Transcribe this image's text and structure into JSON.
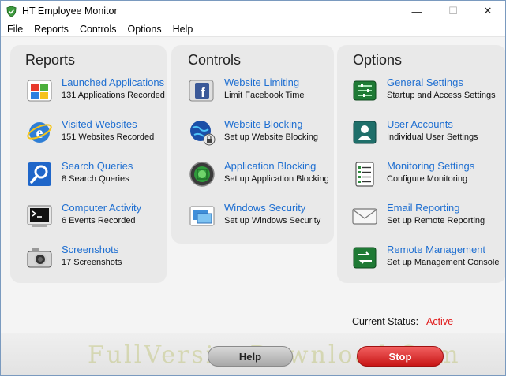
{
  "window": {
    "title": "HT Employee Monitor",
    "minimize_glyph": "—",
    "maximize_glyph": "☐",
    "close_glyph": "✕"
  },
  "menu": [
    "File",
    "Reports",
    "Controls",
    "Options",
    "Help"
  ],
  "reports": {
    "title": "Reports",
    "items": [
      {
        "label": "Launched Applications",
        "sub": "131 Applications Recorded",
        "icon": "applications-icon"
      },
      {
        "label": "Visited Websites",
        "sub": "151 Websites Recorded",
        "icon": "internet-explorer-icon"
      },
      {
        "label": "Search Queries",
        "sub": "8 Search Queries",
        "icon": "search-icon"
      },
      {
        "label": "Computer Activity",
        "sub": "6 Events Recorded",
        "icon": "terminal-icon"
      },
      {
        "label": "Screenshots",
        "sub": "17 Screenshots",
        "icon": "camera-icon"
      }
    ]
  },
  "controls": {
    "title": "Controls",
    "items": [
      {
        "label": "Website Limiting",
        "sub": "Limit Facebook Time",
        "icon": "facebook-icon"
      },
      {
        "label": "Website Blocking",
        "sub": "Set up Website Blocking",
        "icon": "globe-lock-icon"
      },
      {
        "label": "Application Blocking",
        "sub": "Set up Application Blocking",
        "icon": "application-block-icon"
      },
      {
        "label": "Windows Security",
        "sub": "Set up Windows Security",
        "icon": "windows-security-icon"
      }
    ]
  },
  "options": {
    "title": "Options",
    "items": [
      {
        "label": "General Settings",
        "sub": "Startup and Access Settings",
        "icon": "settings-icon"
      },
      {
        "label": "User Accounts",
        "sub": "Individual User Settings",
        "icon": "user-accounts-icon"
      },
      {
        "label": "Monitoring Settings",
        "sub": "Configure Monitoring",
        "icon": "monitoring-icon"
      },
      {
        "label": "Email Reporting",
        "sub": "Set up Remote Reporting",
        "icon": "email-icon"
      },
      {
        "label": "Remote Management",
        "sub": "Set up Management Console",
        "icon": "remote-management-icon"
      }
    ]
  },
  "status": {
    "label": "Current Status:",
    "value": "Active"
  },
  "buttons": {
    "help": "Help",
    "stop": "Stop"
  },
  "watermark": "FullVersionDownload.Com"
}
